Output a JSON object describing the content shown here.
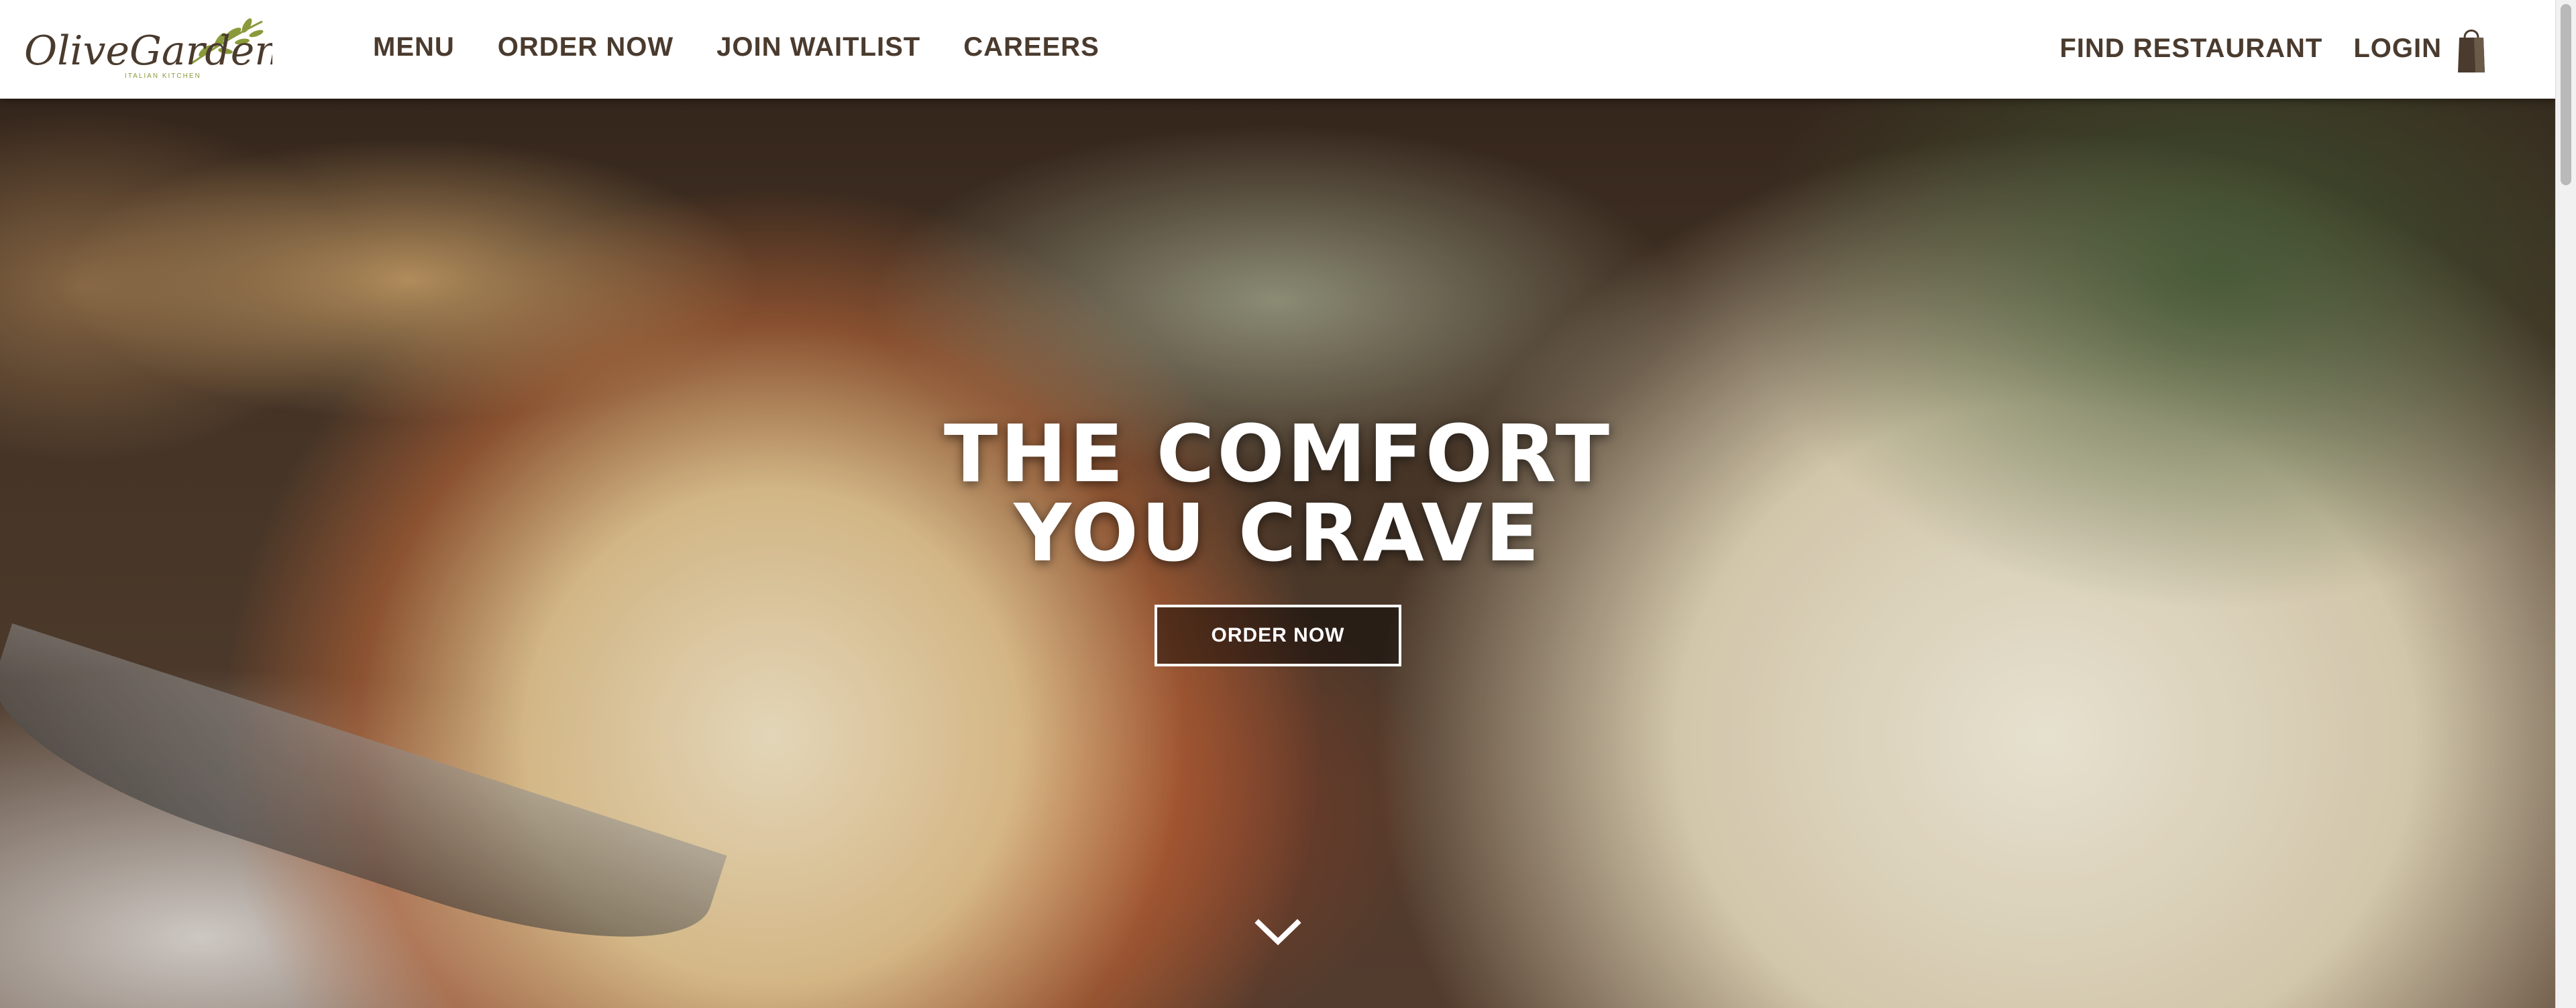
{
  "brand": {
    "name": "OliveGarden",
    "tagline": "ITALIAN KITCHEN",
    "accent_color": "#8a9a3a",
    "text_color": "#4a3b2e"
  },
  "nav": {
    "items": [
      {
        "label": "MENU"
      },
      {
        "label": "ORDER NOW"
      },
      {
        "label": "JOIN WAITLIST"
      },
      {
        "label": "CAREERS"
      }
    ],
    "find_restaurant": "FIND RESTAURANT",
    "login": "LOGIN",
    "bag_icon": "shopping-bag-icon"
  },
  "hero": {
    "headline_line1": "THE COMFORT",
    "headline_line2": "YOU CRAVE",
    "cta_label": "ORDER NOW",
    "scroll_icon": "chevron-down-icon"
  }
}
